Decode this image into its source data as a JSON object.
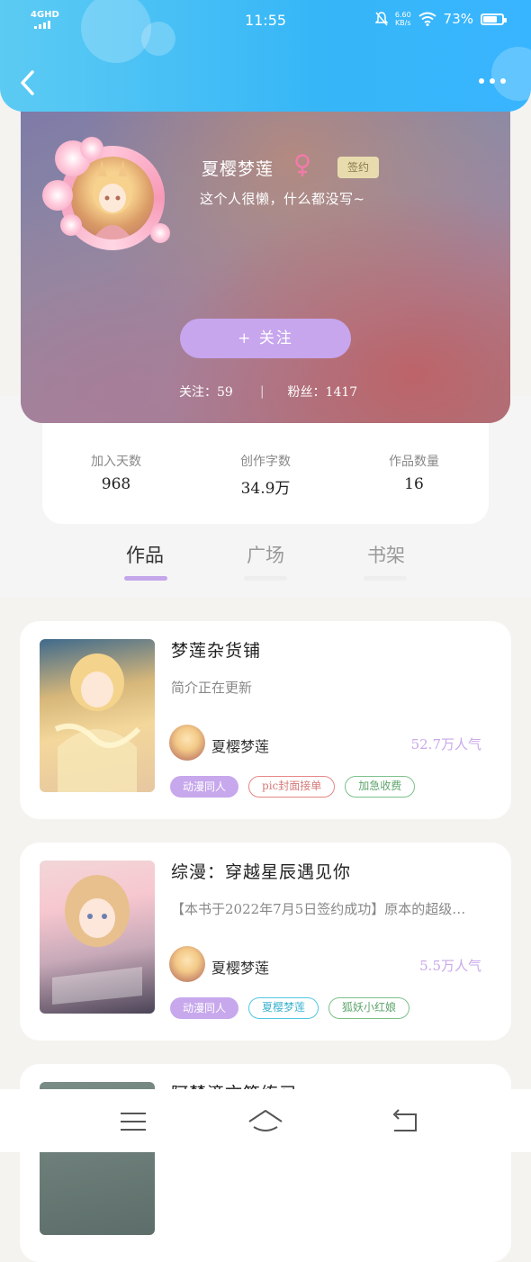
{
  "status_bar": {
    "network": "4GHD",
    "time": "11:55",
    "speed_value": "6.60",
    "speed_unit": "KB/s",
    "battery": "73%",
    "battery_level": 0.73
  },
  "header": {
    "back_icon": "chevron-left-icon",
    "more_icon": "more-dots-icon"
  },
  "profile": {
    "username": "夏樱梦莲",
    "gender_icon": "female-icon",
    "badge": "签约",
    "bio": "这个人很懒，什么都没写~",
    "follow_button": "+  关注",
    "following_label": "关注：59",
    "separator": "|",
    "followers_label": "粉丝：1417"
  },
  "stats": [
    {
      "label": "加入天数",
      "value": "968"
    },
    {
      "label": "创作字数",
      "value": "34.9万"
    },
    {
      "label": "作品数量",
      "value": "16"
    }
  ],
  "tabs": [
    {
      "label": "作品",
      "active": true
    },
    {
      "label": "广场",
      "active": false
    },
    {
      "label": "书架",
      "active": false
    }
  ],
  "books": [
    {
      "title": "梦莲杂货铺",
      "intro": "简介正在更新",
      "author": "夏樱梦莲",
      "popularity": "52.7万人气",
      "tags": [
        {
          "label": "动漫同人",
          "style": "purple"
        },
        {
          "label": "pic封面接单",
          "style": "red"
        },
        {
          "label": "加急收费",
          "style": "green"
        }
      ]
    },
    {
      "title": "综漫：穿越星辰遇见你",
      "intro": "【本书于2022年7月5日签约成功】原本的超级…",
      "author": "夏樱梦莲",
      "popularity": "5.5万人气",
      "tags": [
        {
          "label": "动漫同人",
          "style": "purple"
        },
        {
          "label": "夏樱梦莲",
          "style": "cyan"
        },
        {
          "label": "狐妖小红娘",
          "style": "green"
        }
      ]
    },
    {
      "title": "阿楚滴文笔练习",
      "intro": "",
      "author": "",
      "popularity": "",
      "tags": []
    }
  ],
  "bottom_nav": {
    "menu_icon": "menu-icon",
    "home_icon": "home-icon",
    "back_icon": "return-icon"
  },
  "colors": {
    "accent": "#c7a6ee",
    "header_blue": "#36b6f7"
  }
}
